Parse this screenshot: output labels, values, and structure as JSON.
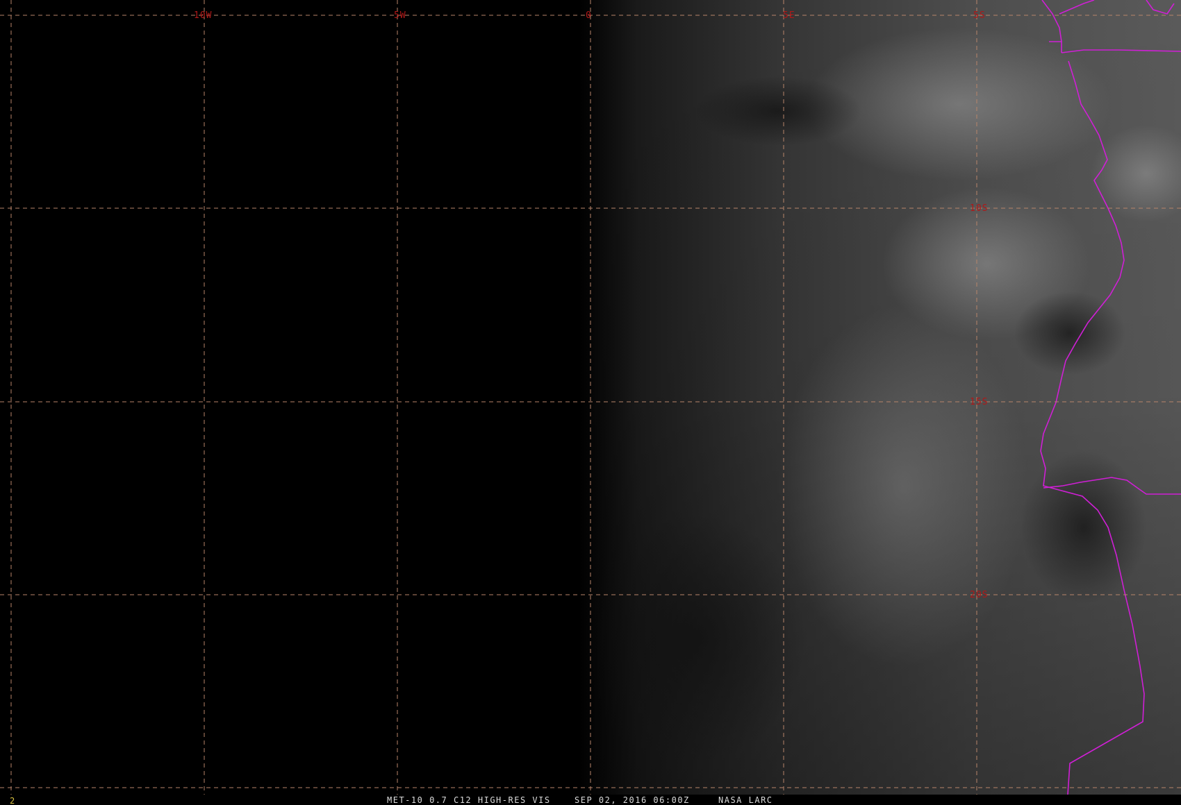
{
  "map": {
    "frame_number": "2",
    "caption": {
      "product": "MET-10 0.7 C12 HIGH-RES VIS",
      "datetime": "SEP 02, 2016 06:00Z",
      "source": "NASA LARC"
    },
    "longitude_labels": [
      "10W",
      "5W",
      "0",
      "5E",
      "5S"
    ],
    "latitude_labels": [
      "10S",
      "15S",
      "20S"
    ],
    "colors": {
      "background": "#000000",
      "grid": "#b8856a",
      "grid_labels": "#b01818",
      "coastline": "#d01fd6",
      "caption": "#dcdcdc",
      "frame_number": "#d8c040"
    }
  }
}
